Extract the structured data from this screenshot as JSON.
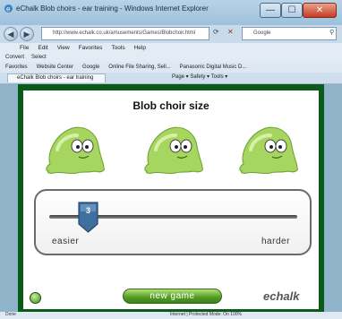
{
  "window": {
    "title": "eChalk Blob choirs - ear training - Windows Internet Explorer",
    "minimize": "—",
    "maximize": "☐",
    "close": "✕"
  },
  "address": {
    "url": "http://www.echalk.co.uk/amusements/Games/Blobchoir.html",
    "search_placeholder": "Google"
  },
  "menu": [
    "File",
    "Edit",
    "View",
    "Favorites",
    "Tools",
    "Help"
  ],
  "toolbar2": [
    "Convert",
    "Select"
  ],
  "favorites": {
    "label": "Favorites",
    "links": [
      "Website Center",
      "Google",
      "Online File Sharing, Sell...",
      "Panasonic Digital Music D..."
    ]
  },
  "tab": {
    "label": "eChalk Blob choirs - ear training"
  },
  "commandbar": {
    "text": "Page ▾  Safety ▾  Tools ▾"
  },
  "game": {
    "title": "Blob choir size",
    "slider": {
      "value": "3",
      "min_label": "easier",
      "max_label": "harder",
      "level": 0.18
    },
    "new_game": "new game",
    "logo": "echalk"
  },
  "status": {
    "left": "Done",
    "right": "Internet | Protected Mode: On   100%"
  },
  "colors": {
    "content_border": "#0a5a1a",
    "button_green": "#4f9a22",
    "thumb_blue": "#3f6f9f",
    "blob_green": "#9fd45a"
  }
}
